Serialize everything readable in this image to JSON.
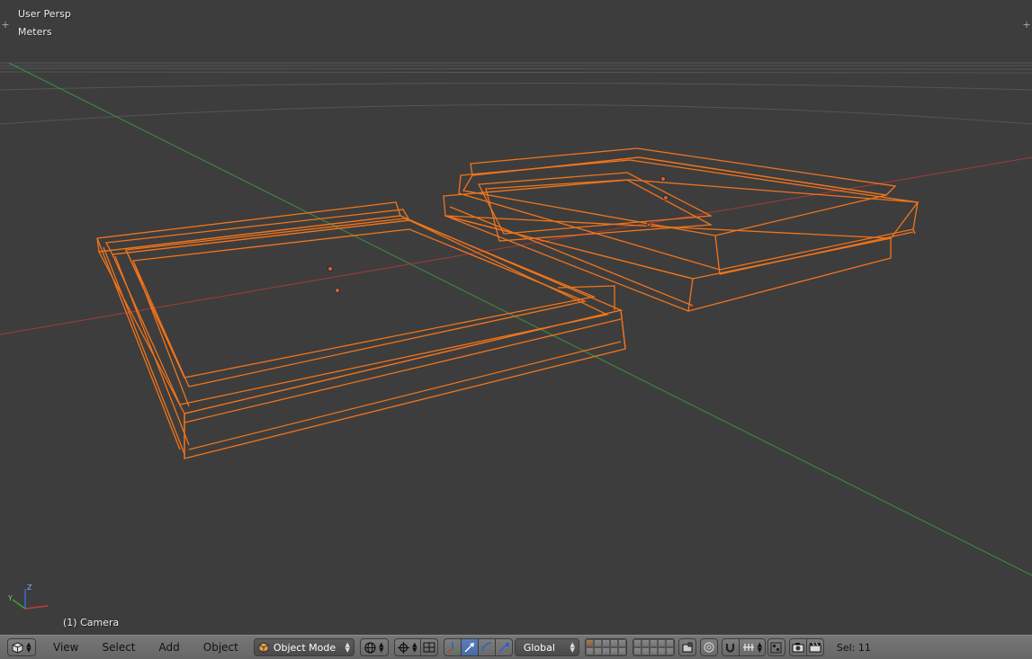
{
  "viewport": {
    "view_name": "User Persp",
    "units": "Meters",
    "active_object": "(1) Camera",
    "axis_gizmo": {
      "x": "X",
      "y": "Y",
      "z": "Z"
    },
    "colors": {
      "background": "#3d3d3d",
      "selection": "#f2741b",
      "x_axis": "#a33a3a",
      "y_axis": "#3f8f3f",
      "grid": "#555555"
    }
  },
  "header": {
    "editor_type_icon": "3d-view-icon",
    "menus": [
      "View",
      "Select",
      "Add",
      "Object"
    ],
    "mode": "Object Mode",
    "pivot_icon": "pivot-icon",
    "manipulator_icons": [
      "manipulator-toggle-icon",
      "translate-icon",
      "rotate-icon",
      "scale-icon"
    ],
    "orientation": "Global",
    "selection_info": "Sel: 11"
  }
}
